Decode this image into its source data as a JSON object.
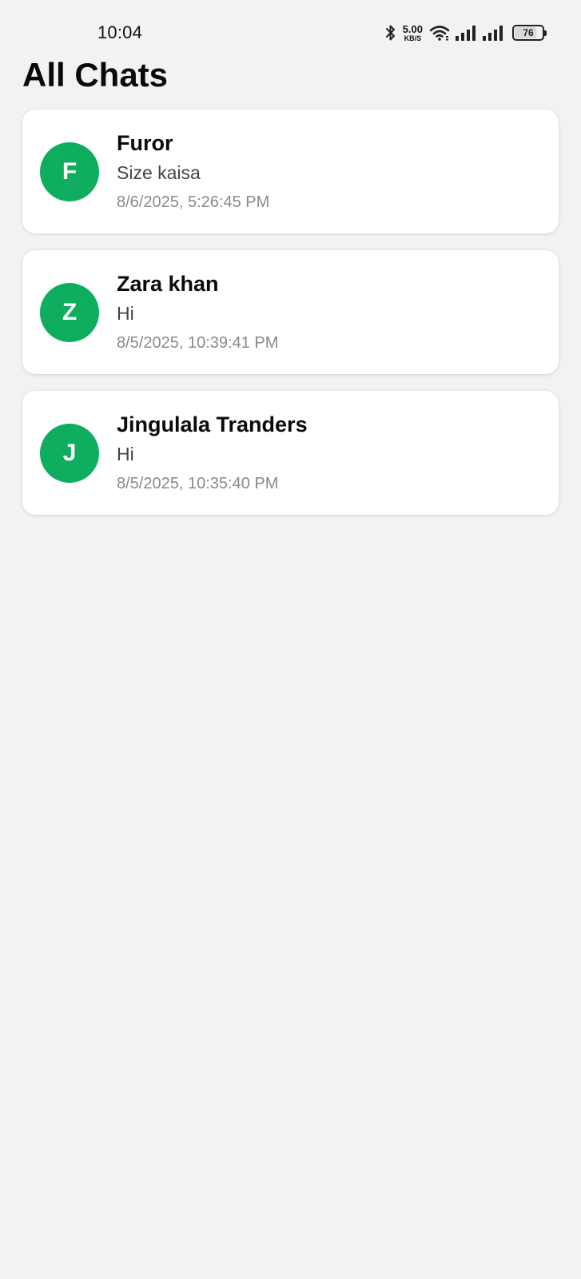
{
  "status_bar": {
    "time": "10:04",
    "net_speed_value": "5.00",
    "net_speed_unit": "KB/S",
    "battery_level": "76",
    "battery_fraction": 0.76,
    "icons": [
      "bluetooth-icon",
      "wifi-icon",
      "signal-icon",
      "signal-icon",
      "battery-icon"
    ]
  },
  "header": {
    "title": "All Chats"
  },
  "theme": {
    "avatar_color": "#0fae5f",
    "background": "#f2f2f2"
  },
  "chats": [
    {
      "initial": "F",
      "name": "Furor",
      "last_message": "Size kaisa",
      "timestamp": "8/6/2025, 5:26:45 PM"
    },
    {
      "initial": "Z",
      "name": "Zara khan",
      "last_message": "Hi",
      "timestamp": "8/5/2025, 10:39:41 PM"
    },
    {
      "initial": "J",
      "name": "Jingulala Tranders",
      "last_message": "Hi",
      "timestamp": "8/5/2025, 10:35:40 PM"
    }
  ]
}
